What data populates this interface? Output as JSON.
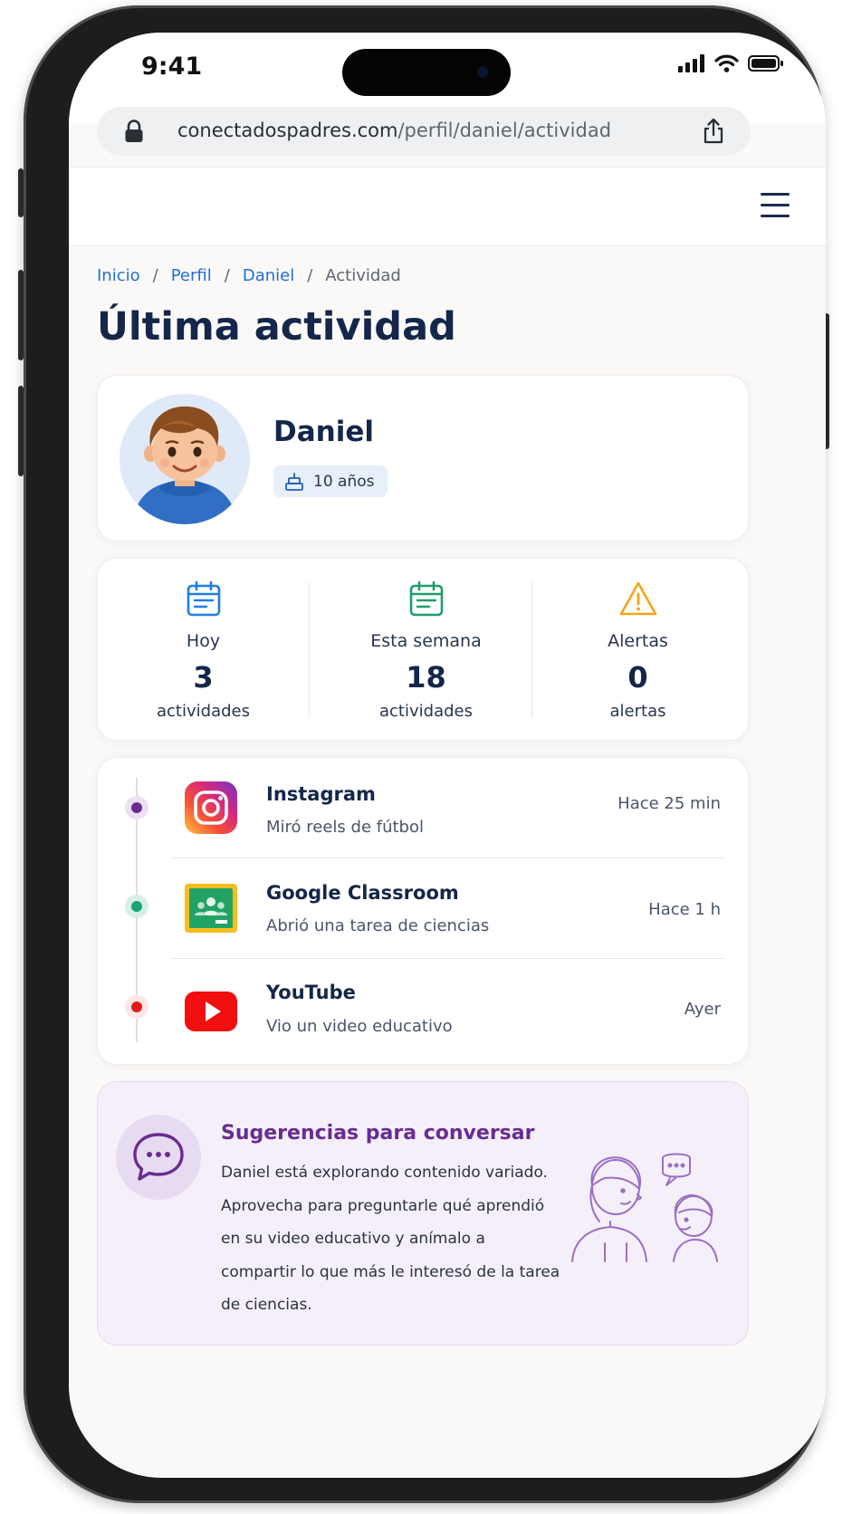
{
  "status_bar": {
    "time": "9:41"
  },
  "browser": {
    "domain": "conectadospadres.com",
    "path": "/perfil/daniel/actividad"
  },
  "breadcrumb": {
    "items": [
      "Inicio",
      "Perfil",
      "Daniel"
    ],
    "current": "Actividad",
    "separator": "/"
  },
  "page": {
    "title": "Última actividad"
  },
  "profile": {
    "name": "Daniel",
    "age": "10 años"
  },
  "stats": [
    {
      "label": "Hoy",
      "value": "3",
      "unit": "actividades",
      "icon": "calendar-icon",
      "color": "#1f7fe0"
    },
    {
      "label": "Esta semana",
      "value": "18",
      "unit": "actividades",
      "icon": "calendar-icon",
      "color": "#1f9d6b"
    },
    {
      "label": "Alertas",
      "value": "0",
      "unit": "alertas",
      "icon": "warning-icon",
      "color": "#f2a516"
    }
  ],
  "activities": [
    {
      "app": "Instagram",
      "description": "Miró reels de fútbol",
      "time": "Hace 25 min",
      "icon": "instagram-icon",
      "dot_color": "#6a2c91"
    },
    {
      "app": "Google Classroom",
      "description": "Abrió una tarea de ciencias",
      "time": "Hace 1 h",
      "icon": "google-classroom-icon",
      "dot_color": "#17a673"
    },
    {
      "app": "YouTube",
      "description": "Vio un video educativo",
      "time": "Ayer",
      "icon": "youtube-icon",
      "dot_color": "#e41b1b"
    }
  ],
  "suggestions": {
    "title": "Sugerencias para conversar",
    "body": "Daniel está explorando contenido variado. Aprovecha para preguntarle qué aprendió en su video educativo y anímalo a compartir lo que más le interesó de la tarea de ciencias."
  },
  "colors": {
    "primary_text": "#14264a",
    "link": "#1f6fd6",
    "suggestion_accent": "#6a2c91"
  }
}
